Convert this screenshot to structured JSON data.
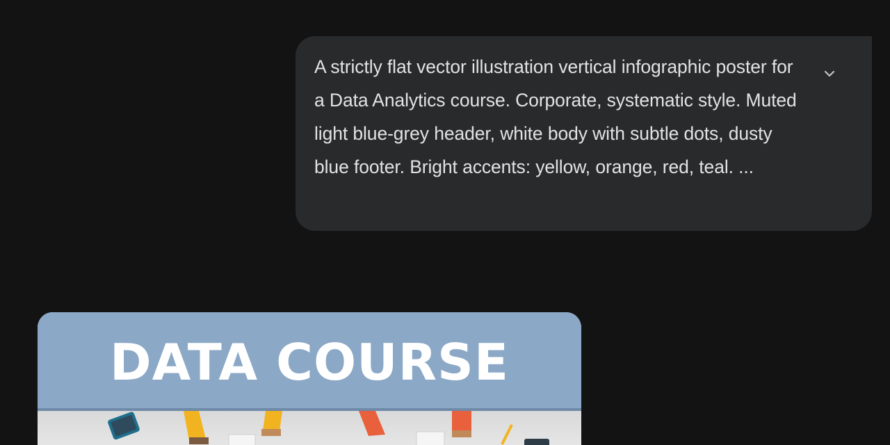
{
  "user_message": {
    "text": "A strictly flat vector illustration vertical infographic poster for a Data Analytics course. Corporate, systematic style. Muted light blue-grey header, white body with subtle dots, dusty blue footer. Bright accents: yellow, orange, red, teal. ...",
    "expand_icon": "chevron-down-icon"
  },
  "generated_image": {
    "title": "DATA COURSE",
    "colors": {
      "header": "#8ba8c6",
      "body": "#e4e4e4",
      "accent_yellow": "#f2b320",
      "accent_orange": "#e8603c",
      "accent_teal": "#1f6f8b"
    }
  }
}
